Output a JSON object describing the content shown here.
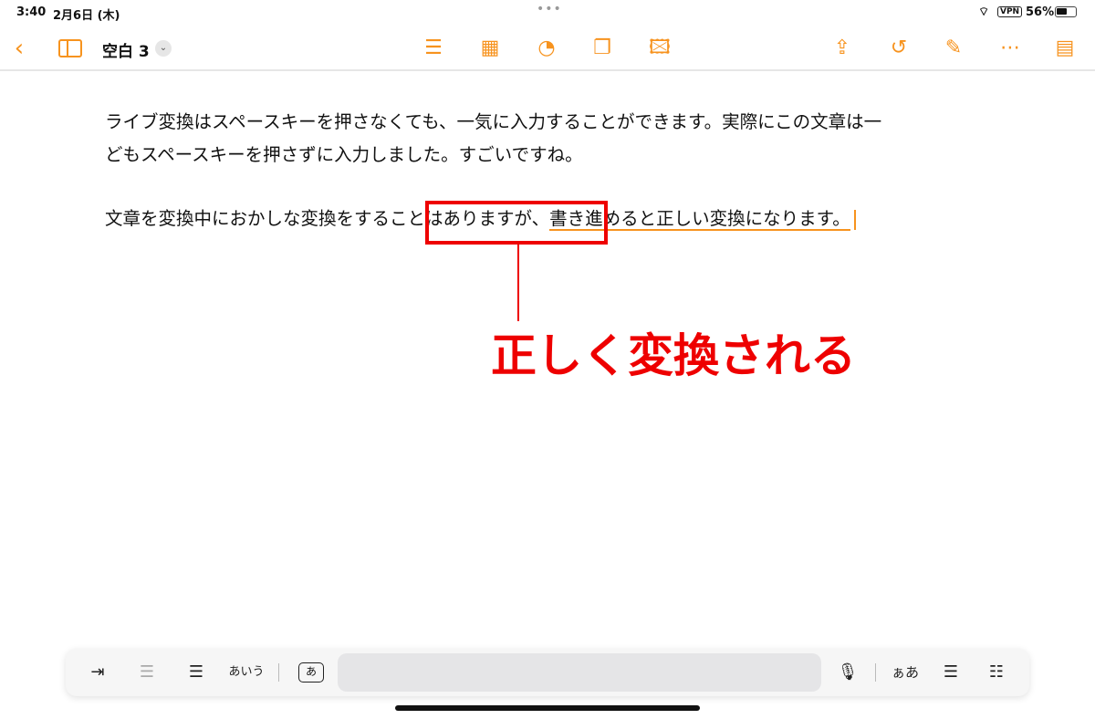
{
  "status": {
    "time": "3:40",
    "date": "2月6日 (木)",
    "vpn": "VPN",
    "battery": "56%"
  },
  "header": {
    "title": "空白 3"
  },
  "doc": {
    "p1_line1": "ライブ変換はスペースキーを押さなくても、一気に入力することができます。実際にこの文章は一",
    "p1_line2": "どもスペースキーを押さずに入力しました。すごいですね。",
    "p2_a": "文章を変換中におかしな変換をする",
    "p2_b": "ことはありますが、",
    "p2_c": "書き進めると正しい変換になります。"
  },
  "annotation": {
    "label": "正しく変換される",
    "color": "#ee0000"
  },
  "keyboard_bar": {
    "kana": "あいう",
    "kana_box": "あ",
    "font_label": "ぁあ"
  },
  "colors": {
    "accent": "#f7931e"
  }
}
